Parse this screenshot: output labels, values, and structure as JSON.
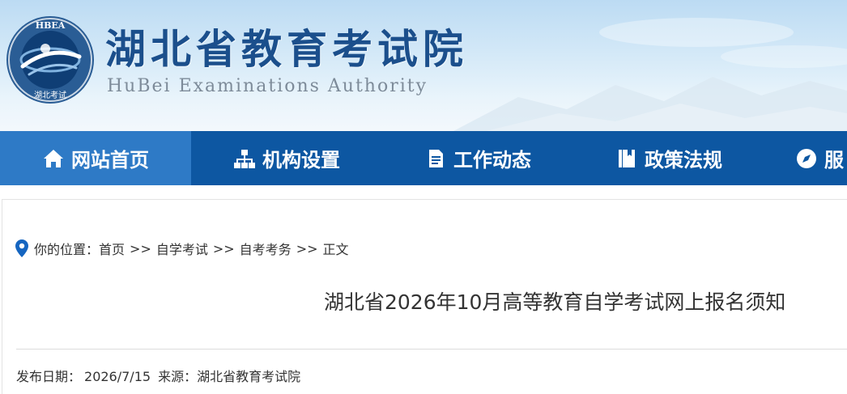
{
  "site": {
    "title_cn": "湖北省教育考试院",
    "title_en": "HuBei Examinations Authority",
    "logo_text_top": "HBEA",
    "logo_text_bottom": "湖北考试"
  },
  "nav": {
    "items": [
      {
        "label": "网站首页",
        "icon": "home-icon",
        "active": true
      },
      {
        "label": "机构设置",
        "icon": "org-chart-icon",
        "active": false
      },
      {
        "label": "工作动态",
        "icon": "document-icon",
        "active": false
      },
      {
        "label": "政策法规",
        "icon": "book-icon",
        "active": false
      },
      {
        "label": "服",
        "icon": "compass-icon",
        "active": false
      }
    ]
  },
  "breadcrumb": {
    "prefix": "你的位置：",
    "items": [
      "首页",
      "自学考试",
      "自考考务",
      "正文"
    ],
    "separator": ">>"
  },
  "article": {
    "title": "湖北省2026年10月高等教育自学考试网上报名须知",
    "date_label": "发布日期：",
    "date": "2026/7/15",
    "source_label": "来源：",
    "source": "湖北省教育考试院"
  },
  "colors": {
    "nav_bg": "#0d57a2",
    "nav_active": "#2e7ac6",
    "title_blue": "#1b4f8c"
  }
}
